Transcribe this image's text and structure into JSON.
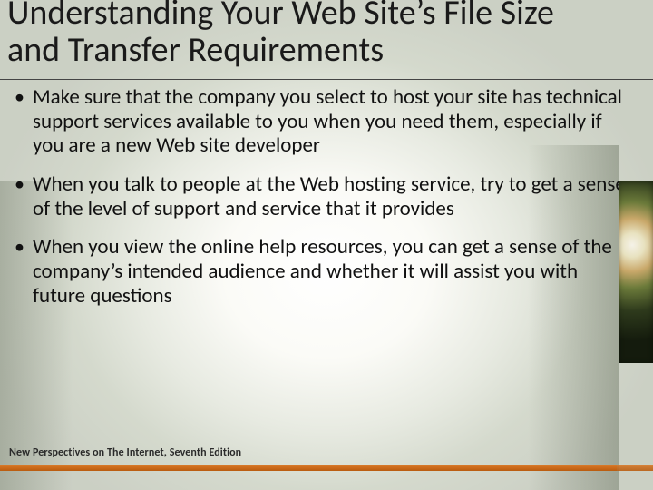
{
  "slide": {
    "title": "Understanding Your Web Site’s File Size and Transfer Requirements",
    "bullets": [
      "Make sure that the company you select to host your site has technical support services available to you when you need them, especially if you are a new Web site developer",
      "When you talk to people at the Web hosting service, try to get a sense of the level of support and service that it provides",
      "When you view the online help resources, you can get a sense of the company’s intended audience and whether it will assist you with future questions"
    ],
    "footer": "New Perspectives on The Internet, Seventh Edition"
  }
}
